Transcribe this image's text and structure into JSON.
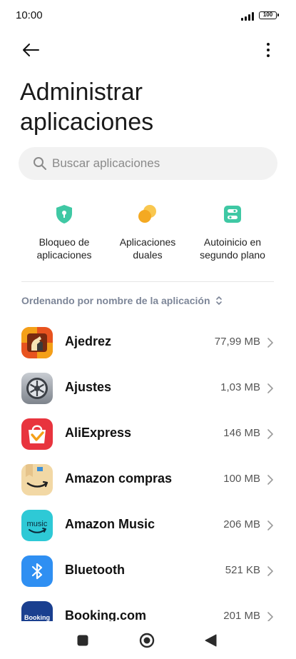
{
  "status_bar": {
    "time": "10:00",
    "battery": "100"
  },
  "header": {
    "title_line1": "Administrar",
    "title_line2": "aplicaciones"
  },
  "search": {
    "placeholder": "Buscar aplicaciones"
  },
  "shortcuts": [
    {
      "line1": "Bloqueo de",
      "line2": "aplicaciones",
      "icon": "shield-lock-icon",
      "color": "#3fc8a4"
    },
    {
      "line1": "Aplicaciones",
      "line2": "duales",
      "icon": "dual-apps-icon",
      "color": "#f7b52c"
    },
    {
      "line1": "Autoinicio en",
      "line2": "segundo plano",
      "icon": "autostart-toggle-icon",
      "color": "#3fc8a4"
    }
  ],
  "sort": {
    "label": "Ordenando por nombre de la aplicación"
  },
  "apps": [
    {
      "name": "Ajedrez",
      "size": "77,99 MB",
      "icon": "chess-icon"
    },
    {
      "name": "Ajustes",
      "size": "1,03 MB",
      "icon": "settings-gear-icon"
    },
    {
      "name": "AliExpress",
      "size": "146 MB",
      "icon": "aliexpress-icon"
    },
    {
      "name": "Amazon compras",
      "size": "100 MB",
      "icon": "amazon-shopping-icon"
    },
    {
      "name": "Amazon Music",
      "size": "206 MB",
      "icon": "amazon-music-icon",
      "icon_text": "music"
    },
    {
      "name": "Bluetooth",
      "size": "521 KB",
      "icon": "bluetooth-icon"
    },
    {
      "name": "Booking.com",
      "size": "201 MB",
      "icon": "booking-icon",
      "icon_text": "Booking"
    }
  ]
}
